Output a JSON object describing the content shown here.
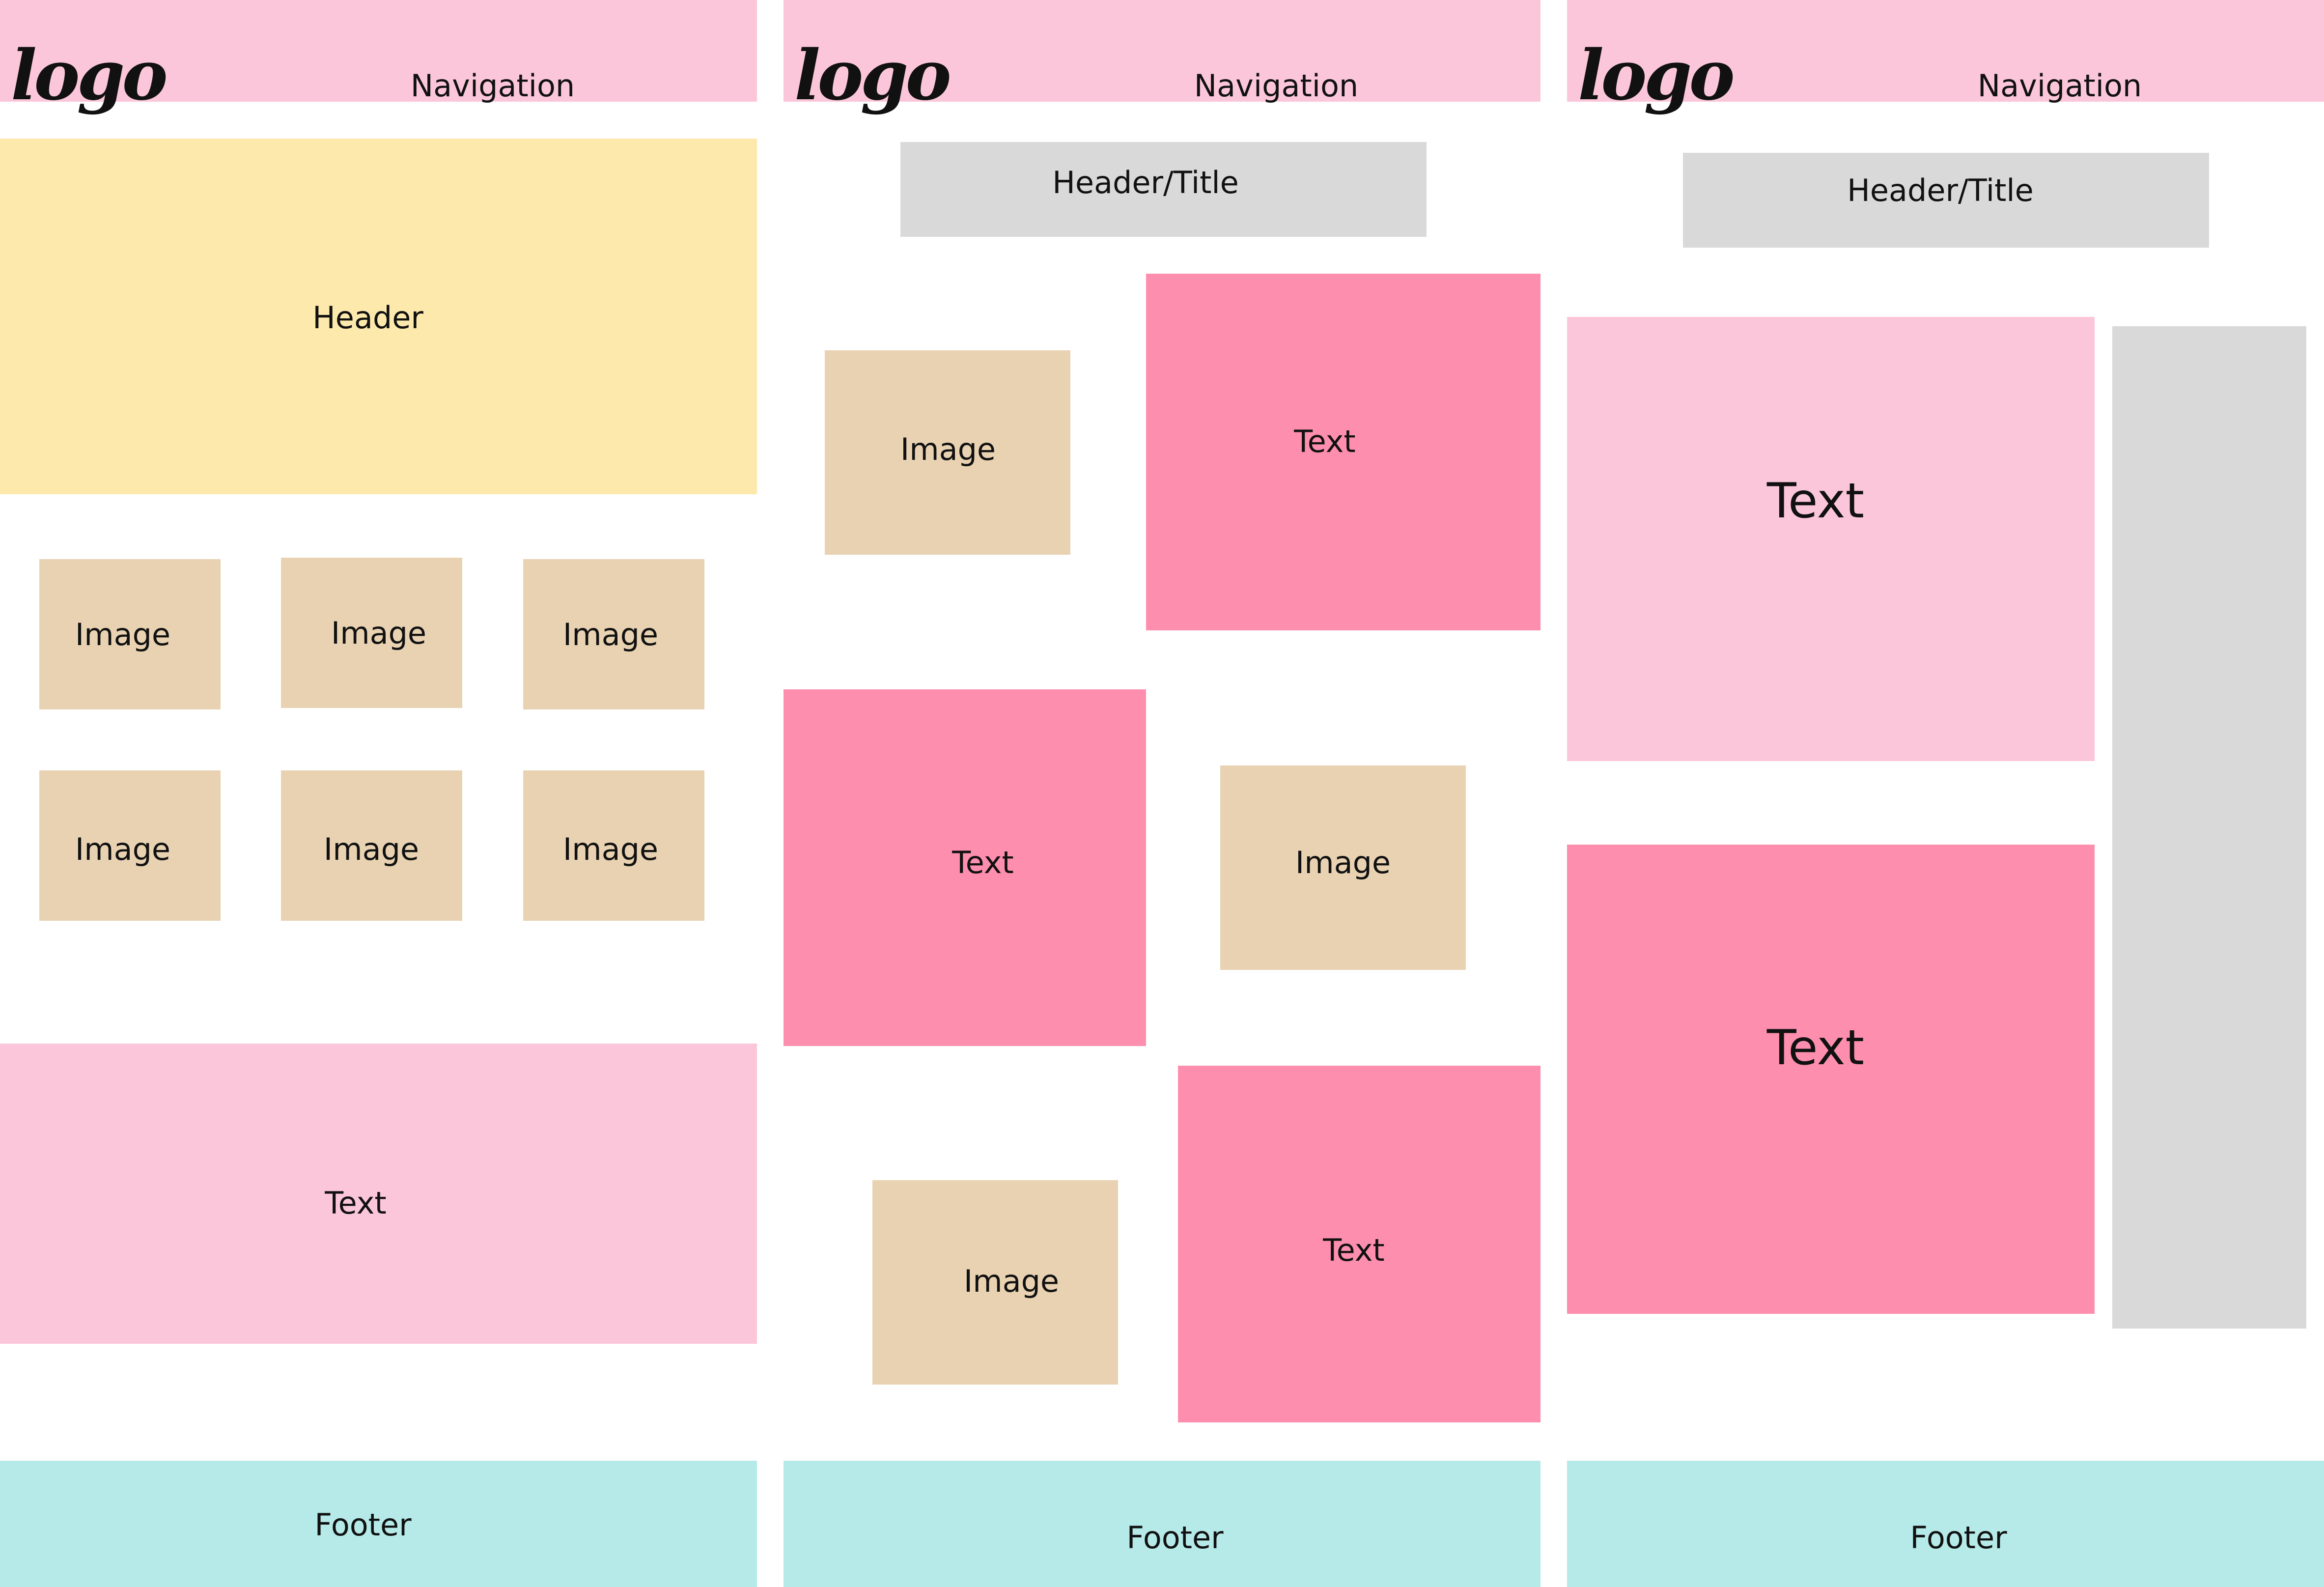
{
  "layouts": [
    {
      "logo": "logo",
      "navigation": "Navigation",
      "header": "Header",
      "images": [
        "Image",
        "Image",
        "Image",
        "Image",
        "Image",
        "Image"
      ],
      "text": "Text",
      "footer": "Footer"
    },
    {
      "logo": "logo",
      "navigation": "Navigation",
      "header_title": "Header/Title",
      "images": [
        "Image",
        "Image",
        "Image"
      ],
      "texts": [
        "Text",
        "Text",
        "Text"
      ],
      "footer": "Footer"
    },
    {
      "logo": "logo",
      "navigation": "Navigation",
      "header_title": "Header/Title",
      "texts": [
        "Text",
        "Text"
      ],
      "footer": "Footer"
    }
  ],
  "colors": {
    "navigation": "#fbc6d9",
    "header": "#fde9ac",
    "image": "#e8d2b2",
    "text_light": "#fbc6d9",
    "text_dark": "#fd8eae",
    "header_title": "#d9d9d9",
    "sidebar": "#d9d9d9",
    "footer": "#b5eae8"
  }
}
